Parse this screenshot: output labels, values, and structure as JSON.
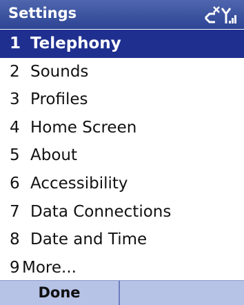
{
  "title": "Settings",
  "status": {
    "connection_icon": "connection-off-icon",
    "signal_icon": "signal-strength-icon"
  },
  "menu": {
    "items": [
      {
        "num": "1",
        "label": "Telephony",
        "selected": true
      },
      {
        "num": "2",
        "label": "Sounds",
        "selected": false
      },
      {
        "num": "3",
        "label": "Profiles",
        "selected": false
      },
      {
        "num": "4",
        "label": "Home Screen",
        "selected": false
      },
      {
        "num": "5",
        "label": "About",
        "selected": false
      },
      {
        "num": "6",
        "label": "Accessibility",
        "selected": false
      },
      {
        "num": "7",
        "label": "Data Connections",
        "selected": false
      },
      {
        "num": "8",
        "label": "Date and Time",
        "selected": false
      },
      {
        "num": "9",
        "label": "More...",
        "selected": false
      }
    ]
  },
  "softkeys": {
    "left": "Done",
    "right": ""
  },
  "colors": {
    "titlebar": "#2c4493",
    "selection": "#1f2f8f",
    "softkey_bar": "#b6c2e6"
  }
}
